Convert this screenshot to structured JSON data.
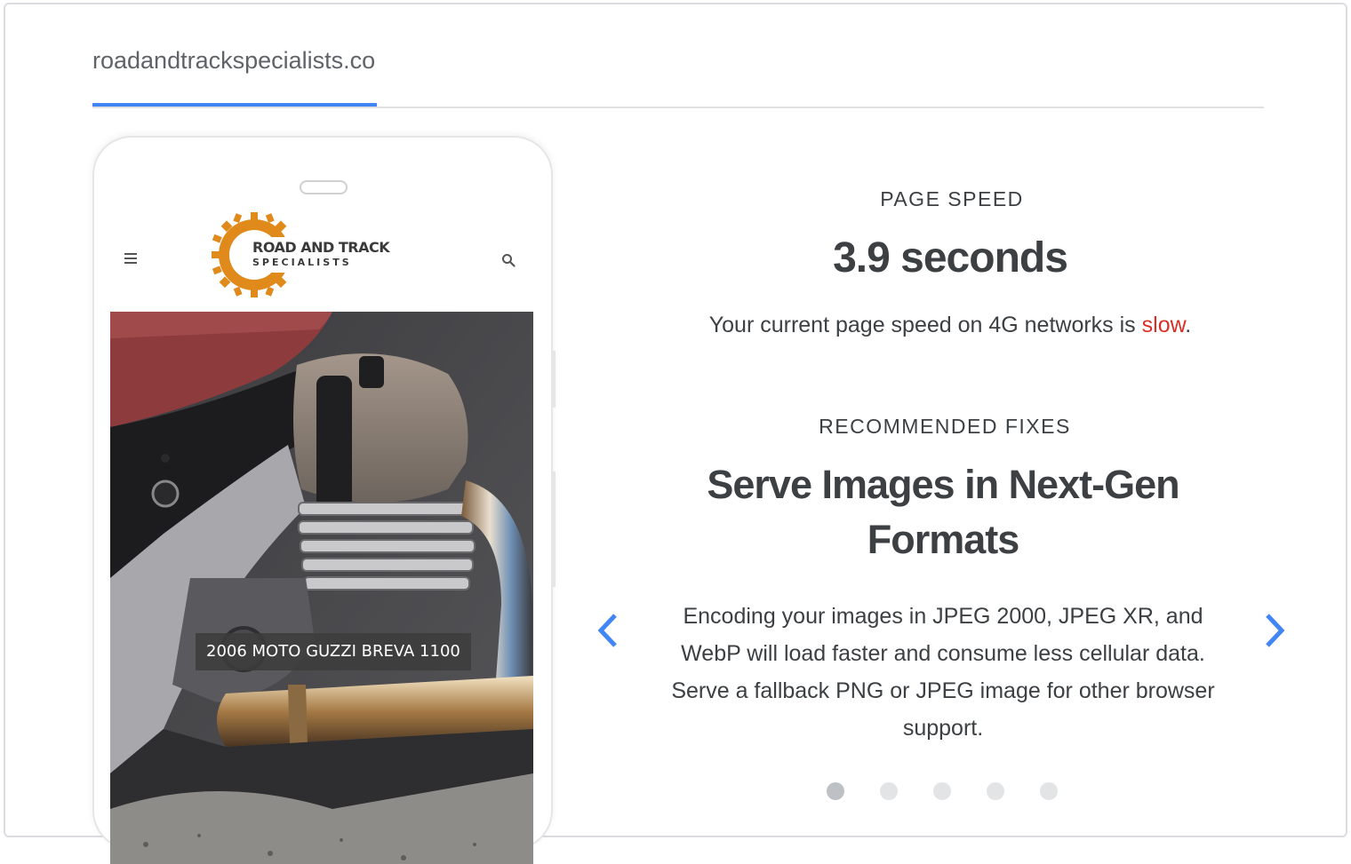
{
  "tabs": [
    {
      "label": "roadandtrackspecialists.com",
      "active": true
    }
  ],
  "phone": {
    "logo": {
      "line1": "ROAD AND TRACK",
      "line2": "SPECIALISTS"
    },
    "caption": "2006 MOTO GUZZI BREVA 1100",
    "icons": [
      "menu-icon",
      "search-icon"
    ]
  },
  "speed": {
    "label": "PAGE SPEED",
    "value": "3.9 seconds",
    "desc_prefix": "Your current page speed on 4G networks is",
    "rating": "slow",
    "desc_suffix": "."
  },
  "fixes": {
    "label": "RECOMMENDED FIXES",
    "title": "Serve Images in Next-Gen Formats",
    "description": "Encoding your images in JPEG 2000, JPEG XR, and WebP will load faster and consume less cellular data. Serve a fallback PNG or JPEG image for other browser support.",
    "slide_count": 5,
    "active_slide": 1
  },
  "colors": {
    "accent": "#4285f4",
    "slow": "#d93025",
    "text": "#3c4043"
  }
}
